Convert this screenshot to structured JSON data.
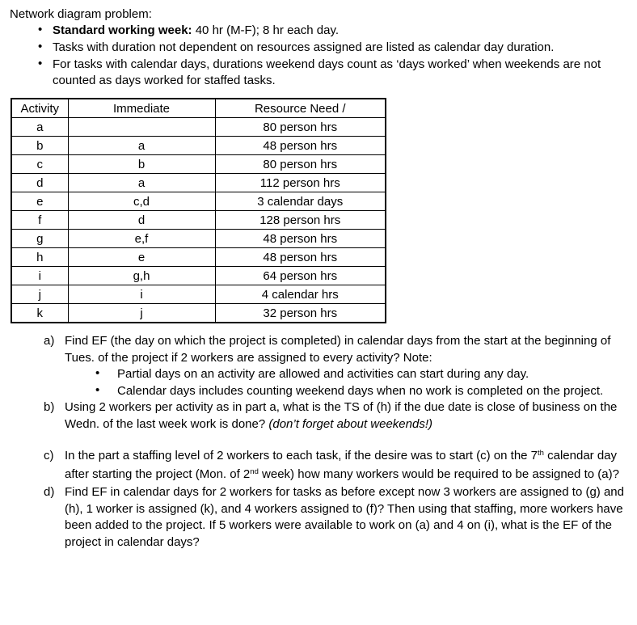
{
  "document": {
    "intro_heading": "Network diagram problem:",
    "intro_bullets": [
      {
        "bold_lead": "Standard working week:",
        "rest": " 40 hr (M-F); 8 hr each day."
      },
      {
        "bold_lead": "",
        "rest": "Tasks with duration not dependent on resources assigned are listed as calendar day duration."
      },
      {
        "bold_lead": "",
        "rest": "For tasks with calendar days, durations weekend days count as ‘days worked’ when weekends are not counted as days worked for staffed tasks."
      }
    ],
    "table": {
      "headers": [
        "Activity",
        "Immediate",
        "Resource Need /"
      ],
      "rows": [
        [
          "a",
          "",
          "80 person hrs"
        ],
        [
          "b",
          "a",
          "48 person hrs"
        ],
        [
          "c",
          "b",
          "80 person hrs"
        ],
        [
          "d",
          "a",
          "112 person hrs"
        ],
        [
          "e",
          "c,d",
          "3 calendar days"
        ],
        [
          "f",
          "d",
          "128 person hrs"
        ],
        [
          "g",
          "e,f",
          "48 person hrs"
        ],
        [
          "h",
          "e",
          "48 person hrs"
        ],
        [
          "i",
          "g,h",
          "64 person hrs"
        ],
        [
          "j",
          "i",
          "4 calendar hrs"
        ],
        [
          "k",
          "j",
          "32 person hrs"
        ]
      ]
    },
    "questions": [
      {
        "marker": "a)",
        "text": "Find EF (the day on which the project is completed) in calendar days from the start at the beginning of Tues. of the project if 2 workers are assigned to every activity? Note:",
        "sub_bullets": [
          "Partial days on an activity are allowed and activities can start during any day.",
          "Calendar days includes counting weekend days when no work is completed on the project."
        ]
      },
      {
        "marker": "b)",
        "text_plain": "Using 2 workers per activity as in part a, what is the TS of (h) if the due date is close of business on the Wedn. of the last week work is done? ",
        "text_italic": "(don’t forget about weekends!)"
      },
      {
        "marker": "c)",
        "part1": "In the part a staffing level of 2 workers to each task, if the desire was to start (c) on the 7",
        "sup1": "th",
        "part2": " calendar day after starting the project (Mon. of 2",
        "sup2": "nd",
        "part3": " week) how many workers would be required to be assigned to (a)?"
      },
      {
        "marker": "d)",
        "text": "Find EF in calendar days for 2 workers for tasks as before except now 3 workers are assigned to (g) and (h), 1 worker is assigned (k), and 4 workers assigned to (f)? Then using that staffing, more workers have been added to the project. If 5 workers were available to work on (a) and 4 on (i), what is the EF of the project in calendar days?"
      }
    ]
  }
}
